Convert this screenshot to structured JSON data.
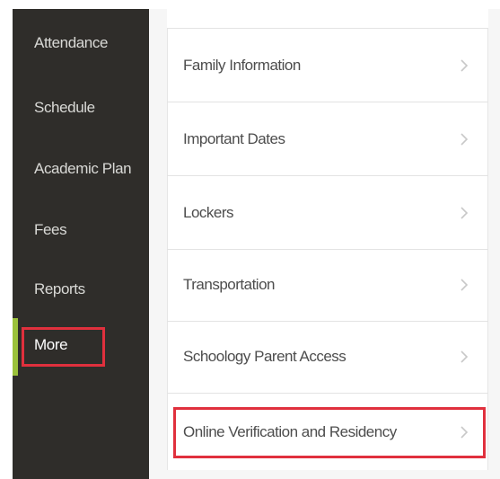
{
  "sidebar": {
    "items": [
      {
        "label": "Attendance"
      },
      {
        "label": "Schedule"
      },
      {
        "label": "Academic Plan"
      },
      {
        "label": "Fees"
      },
      {
        "label": "Reports"
      },
      {
        "label": "More",
        "active": true
      }
    ]
  },
  "menu": {
    "items": [
      {
        "label": "Family Information"
      },
      {
        "label": "Important Dates"
      },
      {
        "label": "Lockers"
      },
      {
        "label": "Transportation"
      },
      {
        "label": "Schoology Parent Access"
      },
      {
        "label": "Online Verification and Residency",
        "highlighted": true
      }
    ]
  },
  "colors": {
    "sidebar_bg": "#2f2d2a",
    "sidebar_accent": "#9bc13b",
    "highlight_border": "#e0303d",
    "row_text": "#4d4d4d",
    "chevron": "#c8c8c8"
  },
  "icons": {
    "row_chevron": "chevron-right-icon"
  }
}
